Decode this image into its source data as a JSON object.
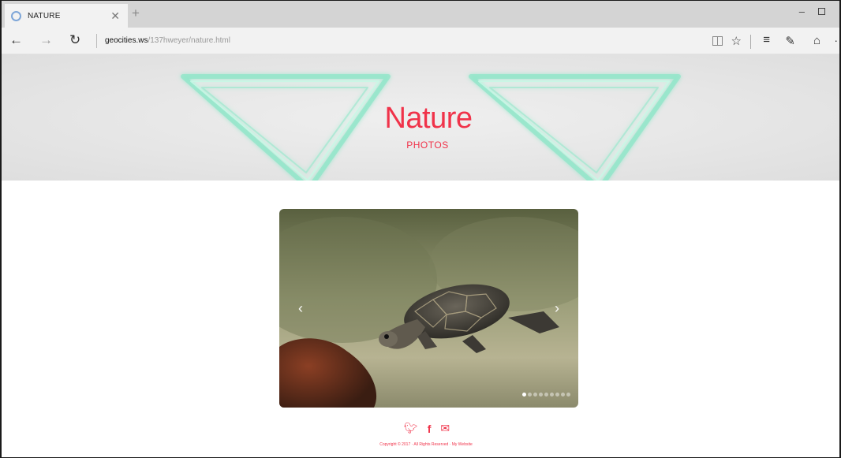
{
  "browser": {
    "tab": {
      "title": "NATURE",
      "favicon": "edge-page-icon"
    },
    "address": {
      "host": "geocities.ws",
      "path": "/137hweyer/nature.html"
    }
  },
  "header": {
    "title": "Nature",
    "subtitle": "PHOTOS"
  },
  "slider": {
    "image": "turtle-swimming-photo",
    "dot_count": 9,
    "active_index": 0,
    "prev_label": "‹",
    "next_label": "›"
  },
  "footer": {
    "social": [
      "twitter-icon",
      "facebook-icon",
      "mail-icon"
    ],
    "copyright": "Copyright © 2017 · All Rights Reserved · My Website"
  },
  "colors": {
    "accent": "#f0334a",
    "neon": "#8fe6c8",
    "tab_strip": "#d4d4d4"
  }
}
